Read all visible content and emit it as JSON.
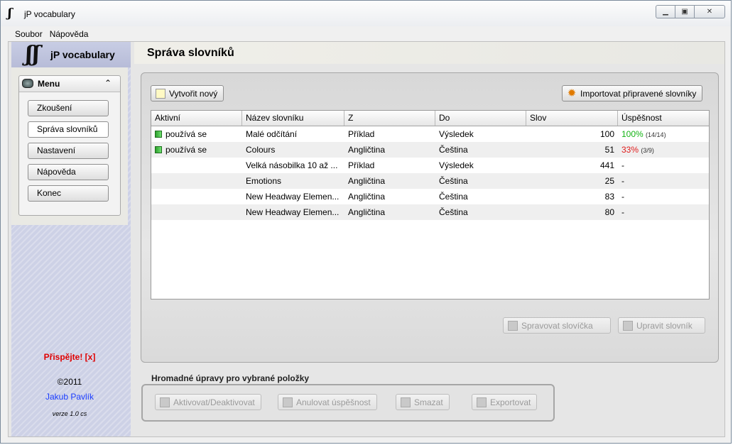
{
  "window": {
    "title": "jP vocabulary",
    "icon": "jp-logo-icon"
  },
  "menubar": {
    "items": [
      "Soubor",
      "Nápověda"
    ]
  },
  "sidebar": {
    "logo_text": "jP vocabulary",
    "menu_title": "Menu",
    "nav": [
      "Zkoušení",
      "Správa slovníků",
      "Nastavení",
      "Nápověda",
      "Konec"
    ],
    "active_index": 1,
    "donate": "Přispějte! [x]",
    "copyright": "©2011",
    "author": "Jakub Pavlík",
    "version": "verze 1.0 cs"
  },
  "page": {
    "title": "Správa slovníků"
  },
  "toolbar": {
    "new_label": "Vytvořit nový",
    "import_label": "Importovat připravené slovníky"
  },
  "table": {
    "columns": [
      "Aktivní",
      "Název slovníku",
      "Z",
      "Do",
      "Slov",
      "Úspěšnost"
    ],
    "rows": [
      {
        "active": "používá se",
        "name": "Malé odčítání",
        "from": "Příklad",
        "to": "Výsledek",
        "words": "100",
        "pct": "100%",
        "frac": "(14/14)",
        "pct_class": "good"
      },
      {
        "active": "používá se",
        "name": "Colours",
        "from": "Angličtina",
        "to": "Čeština",
        "words": "51",
        "pct": "33%",
        "frac": "(3/9)",
        "pct_class": "bad"
      },
      {
        "active": "",
        "name": "Velká násobilka 10 až ...",
        "from": "Příklad",
        "to": "Výsledek",
        "words": "441",
        "pct": "-",
        "frac": "",
        "pct_class": ""
      },
      {
        "active": "",
        "name": "Emotions",
        "from": "Angličtina",
        "to": "Čeština",
        "words": "25",
        "pct": "-",
        "frac": "",
        "pct_class": ""
      },
      {
        "active": "",
        "name": "New Headway Elemen...",
        "from": "Angličtina",
        "to": "Čeština",
        "words": "83",
        "pct": "-",
        "frac": "",
        "pct_class": ""
      },
      {
        "active": "",
        "name": "New Headway Elemen...",
        "from": "Angličtina",
        "to": "Čeština",
        "words": "80",
        "pct": "-",
        "frac": "",
        "pct_class": ""
      }
    ]
  },
  "actions": {
    "manage_words": "Spravovat slovíčka",
    "edit_dict": "Upravit slovník"
  },
  "bulk": {
    "title": "Hromadné úpravy pro vybrané položky",
    "buttons": [
      "Aktivovat/Deaktivovat",
      "Anulovat úspěšnost",
      "Smazat",
      "Exportovat"
    ]
  },
  "colors": {
    "active_green": "#2fa02f",
    "good": "#13b313",
    "bad": "#e01c1c",
    "donate": "#e00000",
    "link": "#1a3cff"
  }
}
